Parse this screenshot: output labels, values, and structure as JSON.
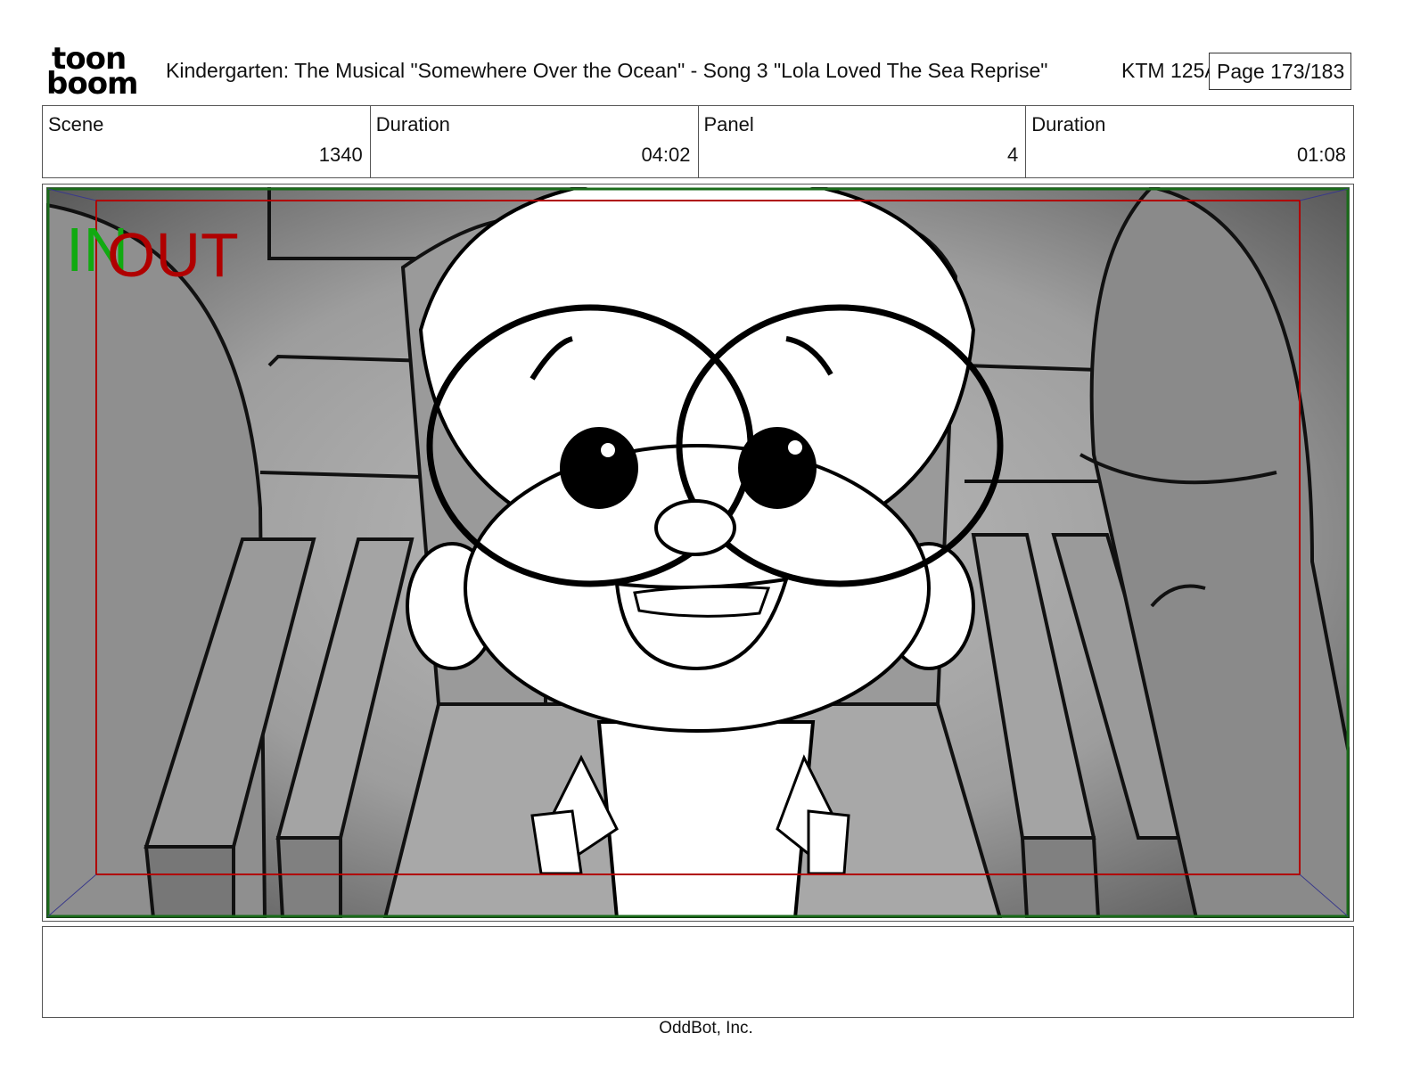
{
  "header": {
    "logo_line1": "toon",
    "logo_line2": "boom",
    "title": "Kindergarten: The Musical  \"Somewhere Over the Ocean\" - Song 3 \"Lola Loved The Sea Reprise\"",
    "code": "KTM 125A",
    "page": "Page 173/183"
  },
  "info": {
    "scene_label": "Scene",
    "scene_value": "1340",
    "scene_duration_label": "Duration",
    "scene_duration_value": "04:02",
    "panel_label": "Panel",
    "panel_value": "4",
    "panel_duration_label": "Duration",
    "panel_duration_value": "01:08"
  },
  "panel": {
    "in_label": "IN",
    "out_label": "OUT",
    "in_color": "#11aa11",
    "out_color": "#b00000"
  },
  "notes": "",
  "footer": "OddBot, Inc."
}
